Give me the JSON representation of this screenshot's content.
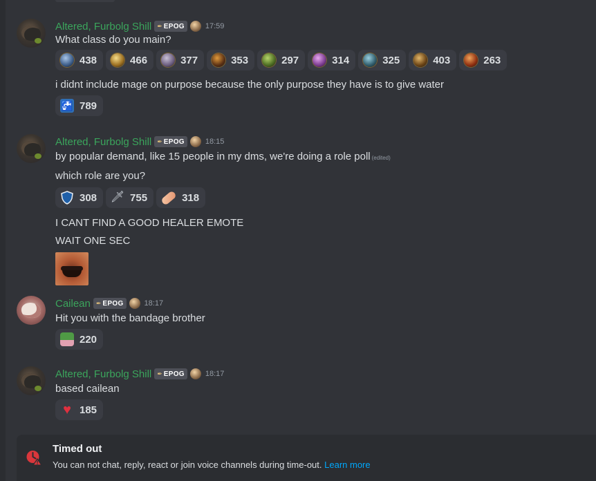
{
  "messages": [
    {
      "author": "Altered, Furbolg Shill",
      "role_tag": "EPOG",
      "time": "17:59",
      "lines": [
        "What class do you main?"
      ],
      "reactions": [
        {
          "icon": "warrior-class-icon",
          "count": "438"
        },
        {
          "icon": "paladin-class-icon",
          "count": "466"
        },
        {
          "icon": "priest-class-icon",
          "count": "377"
        },
        {
          "icon": "rogue-class-icon",
          "count": "353"
        },
        {
          "icon": "hunter-class-icon",
          "count": "297"
        },
        {
          "icon": "warlock-class-icon",
          "count": "314"
        },
        {
          "icon": "shaman-class-icon",
          "count": "325"
        },
        {
          "icon": "druid-class-icon",
          "count": "403"
        },
        {
          "icon": "mage-class-icon",
          "count": "263"
        }
      ],
      "follow_up": "i didnt include mage on purpose because the only purpose they have is to give water",
      "follow_reactions": [
        {
          "icon": "water-tap-icon",
          "count": "789"
        }
      ]
    },
    {
      "author": "Altered, Furbolg Shill",
      "role_tag": "EPOG",
      "time": "18:15",
      "lines": [
        "by popular demand, like 15 people in my dms, we're doing a role poll",
        "which role are you?"
      ],
      "edited": "(edited)",
      "reactions": [
        {
          "icon": "shield-icon",
          "count": "308"
        },
        {
          "icon": "dagger-icon",
          "count": "755"
        },
        {
          "icon": "bandage-icon",
          "count": "318"
        }
      ],
      "follow_lines": [
        "I CANT FIND A GOOD HEALER EMOTE",
        "WAIT ONE SEC"
      ]
    },
    {
      "author": "Cailean",
      "role_tag": "EPOG",
      "time": "18:17",
      "lines": [
        "Hit you with the bandage brother"
      ],
      "reactions": [
        {
          "icon": "pepe-bandage-icon",
          "count": "220"
        }
      ]
    },
    {
      "author": "Altered, Furbolg Shill",
      "role_tag": "EPOG",
      "time": "18:17",
      "lines": [
        "based cailean"
      ],
      "reactions": [
        {
          "icon": "heart-icon",
          "count": "185"
        }
      ]
    }
  ],
  "timeout": {
    "title": "Timed out",
    "description": "You can not chat, reply, react or join voice channels during time-out.",
    "link": "Learn more"
  },
  "colors": {
    "background": "#313338",
    "username": "#3ba55c",
    "link": "#00a8fc",
    "timeout_icon": "#da373c"
  }
}
